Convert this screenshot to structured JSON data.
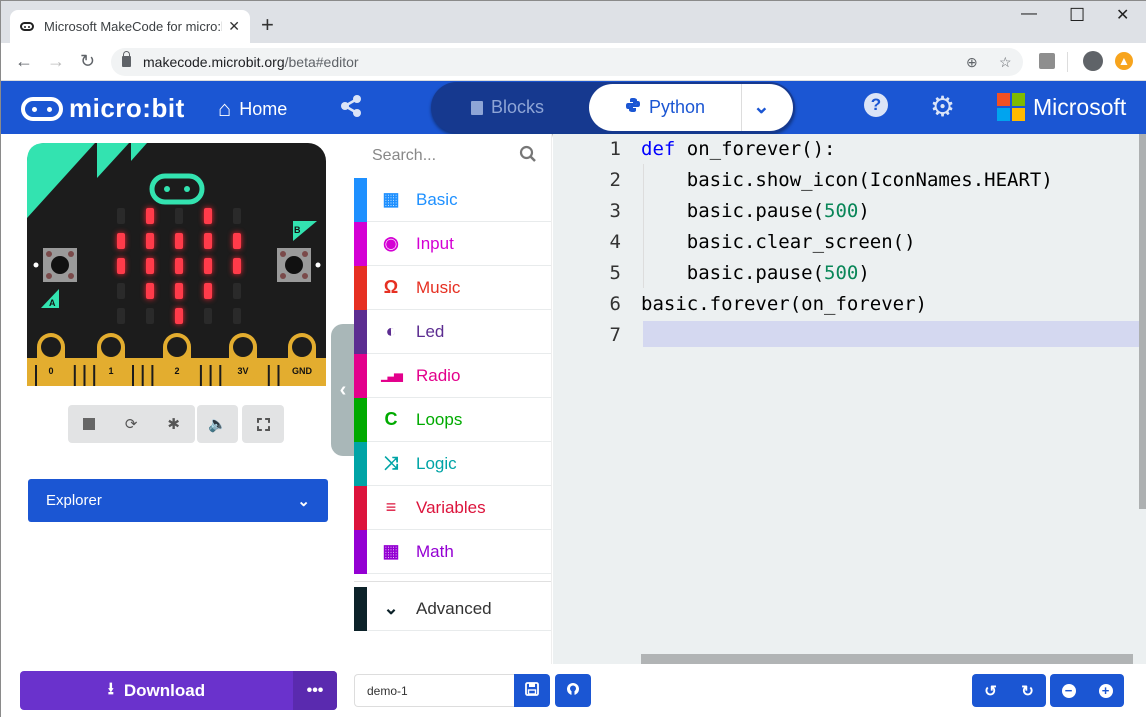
{
  "browser": {
    "tab_title": "Microsoft MakeCode for micro:bit",
    "tab_close": "✕",
    "new_tab": "+",
    "url_host": "makecode.microbit.org",
    "url_path": "/beta#editor",
    "window_min": "—",
    "window_max": "☐",
    "window_close": "✕"
  },
  "header": {
    "logo_text": "micro:bit",
    "home_label": "Home",
    "mode_blocks": "Blocks",
    "mode_python": "Python",
    "help": "?",
    "brand": "Microsoft",
    "brand_colors": [
      "#f25022",
      "#7fba00",
      "#00a4ef",
      "#ffb900"
    ]
  },
  "simulator": {
    "led_grid": [
      [
        0,
        1,
        0,
        1,
        0
      ],
      [
        1,
        1,
        1,
        1,
        1
      ],
      [
        1,
        1,
        1,
        1,
        1
      ],
      [
        0,
        1,
        1,
        1,
        0
      ],
      [
        0,
        0,
        1,
        0,
        0
      ]
    ],
    "button_a": "A",
    "button_b": "B",
    "pins": [
      "0",
      "1",
      "2",
      "3V",
      "GND"
    ],
    "explorer_label": "Explorer"
  },
  "toolbox": {
    "search_placeholder": "Search...",
    "categories": [
      {
        "label": "Basic",
        "color": "#1e90ff",
        "icon": "grid-icon"
      },
      {
        "label": "Input",
        "color": "#d400d4",
        "icon": "target-icon"
      },
      {
        "label": "Music",
        "color": "#e63022",
        "icon": "headphones-icon"
      },
      {
        "label": "Led",
        "color": "#5c2d91",
        "icon": "toggle-icon"
      },
      {
        "label": "Radio",
        "color": "#e3008c",
        "icon": "signal-icon"
      },
      {
        "label": "Loops",
        "color": "#00aa00",
        "icon": "refresh-icon"
      },
      {
        "label": "Logic",
        "color": "#00a4a6",
        "icon": "shuffle-icon"
      },
      {
        "label": "Variables",
        "color": "#dc143c",
        "icon": "list-icon"
      },
      {
        "label": "Math",
        "color": "#9400d3",
        "icon": "calculator-icon"
      }
    ],
    "advanced_label": "Advanced",
    "advanced_color": "#0c2229"
  },
  "editor": {
    "lines": [
      {
        "n": "1",
        "parts": [
          {
            "t": "def",
            "c": "kw"
          },
          {
            "t": " on_forever():",
            "c": ""
          }
        ]
      },
      {
        "n": "2",
        "parts": [
          {
            "t": "    basic.show_icon(IconNames.HEART)",
            "c": ""
          }
        ]
      },
      {
        "n": "3",
        "parts": [
          {
            "t": "    basic.pause(",
            "c": ""
          },
          {
            "t": "500",
            "c": "num"
          },
          {
            "t": ")",
            "c": ""
          }
        ]
      },
      {
        "n": "4",
        "parts": [
          {
            "t": "    basic.clear_screen()",
            "c": ""
          }
        ]
      },
      {
        "n": "5",
        "parts": [
          {
            "t": "    basic.pause(",
            "c": ""
          },
          {
            "t": "500",
            "c": "num"
          },
          {
            "t": ")",
            "c": ""
          }
        ]
      },
      {
        "n": "6",
        "parts": [
          {
            "t": "basic.forever(on_forever)",
            "c": ""
          }
        ]
      },
      {
        "n": "7",
        "parts": []
      }
    ]
  },
  "footer": {
    "download_label": "Download",
    "more_label": "•••",
    "project_name": "demo-1"
  }
}
